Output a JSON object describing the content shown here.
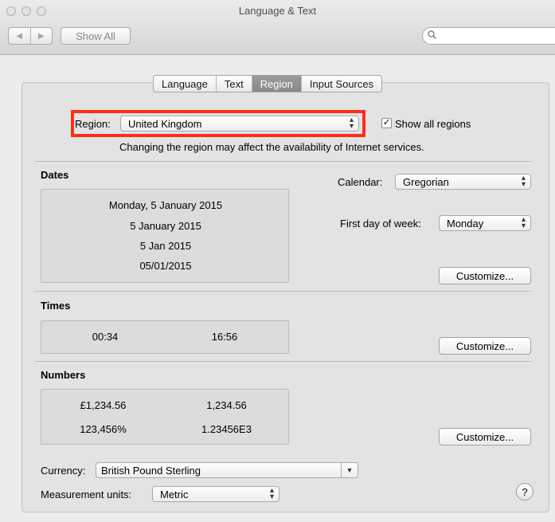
{
  "window": {
    "title": "Language & Text"
  },
  "toolbar": {
    "show_all": "Show All",
    "back_glyph": "◀",
    "forward_glyph": "▶",
    "search_glyph": "🔍"
  },
  "tabs": [
    {
      "label": "Language",
      "active": false
    },
    {
      "label": "Text",
      "active": false
    },
    {
      "label": "Region",
      "active": true
    },
    {
      "label": "Input Sources",
      "active": false
    }
  ],
  "region": {
    "label": "Region:",
    "value": "United Kingdom",
    "show_all_label": "Show all regions",
    "show_all_checked": true,
    "warning": "Changing the region may affect the availability of Internet services."
  },
  "dates": {
    "heading": "Dates",
    "samples": [
      "Monday, 5 January 2015",
      "5 January 2015",
      "5 Jan 2015",
      "05/01/2015"
    ],
    "calendar_label": "Calendar:",
    "calendar_value": "Gregorian",
    "first_day_label": "First day of week:",
    "first_day_value": "Monday",
    "customize": "Customize..."
  },
  "times": {
    "heading": "Times",
    "samples": [
      "00:34",
      "16:56"
    ],
    "customize": "Customize..."
  },
  "numbers": {
    "heading": "Numbers",
    "samples": [
      "£1,234.56",
      "1,234.56",
      "123,456%",
      "1.23456E3"
    ],
    "customize": "Customize..."
  },
  "currency": {
    "label": "Currency:",
    "value": "British Pound Sterling"
  },
  "measurement": {
    "label": "Measurement units:",
    "value": "Metric"
  },
  "help": {
    "glyph": "?"
  },
  "colors": {
    "highlight": "#ff2d16",
    "active_tab": "#8f8f8f"
  }
}
